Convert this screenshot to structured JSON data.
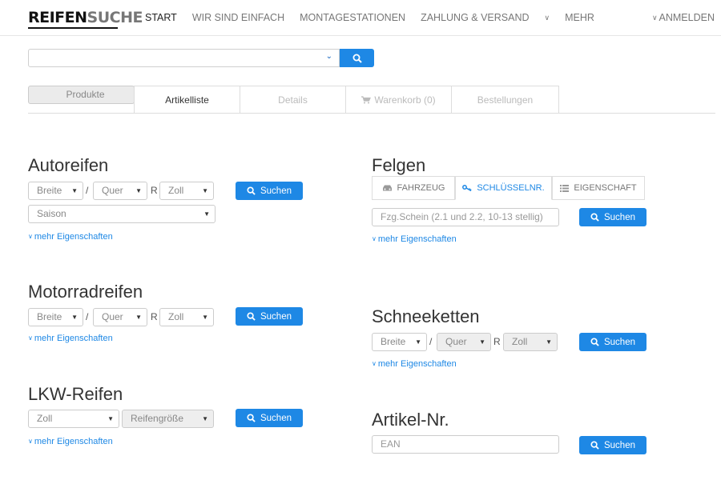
{
  "brand": {
    "part1": "REIFEN",
    "part2": "SUCHE"
  },
  "nav": {
    "items": [
      "START",
      "WIR SIND EINFACH",
      "MONTAGESTATIONEN",
      "ZAHLUNG & VERSAND",
      "MEHR"
    ],
    "login": "ANMELDEN"
  },
  "search": {
    "value": "",
    "button_icon": "search-icon"
  },
  "tabs": [
    {
      "label": "Produkte",
      "state": "selected"
    },
    {
      "label": "Artikelliste",
      "state": "normal"
    },
    {
      "label": "Details",
      "state": "disabled"
    },
    {
      "label": "Warenkorb (0)",
      "state": "disabled",
      "icon": "cart-icon"
    },
    {
      "label": "Bestellungen",
      "state": "disabled"
    }
  ],
  "common": {
    "search_btn": "Suchen",
    "more": "mehr Eigenschaften",
    "slash": "/",
    "r": "R"
  },
  "autoreifen": {
    "title": "Autoreifen",
    "breite": "Breite",
    "quer": "Quer",
    "zoll": "Zoll",
    "saison": "Saison"
  },
  "motorrad": {
    "title": "Motorradreifen",
    "breite": "Breite",
    "quer": "Quer",
    "zoll": "Zoll"
  },
  "lkw": {
    "title": "LKW-Reifen",
    "zoll": "Zoll",
    "groesse": "Reifengröße"
  },
  "felgen": {
    "title": "Felgen",
    "tabs": [
      "FAHRZEUG",
      "SCHLÜSSELNR.",
      "EIGENSCHAFT"
    ],
    "active_tab": "SCHLÜSSELNR.",
    "placeholder": "Fzg.Schein (2.1 und 2.2, 10-13 stellig)"
  },
  "schneeketten": {
    "title": "Schneeketten",
    "breite": "Breite",
    "quer": "Quer",
    "zoll": "Zoll"
  },
  "artikel": {
    "title": "Artikel-Nr.",
    "placeholder": "EAN"
  },
  "colors": {
    "accent": "#1e88e5",
    "selected_tab": "#ebebeb"
  }
}
